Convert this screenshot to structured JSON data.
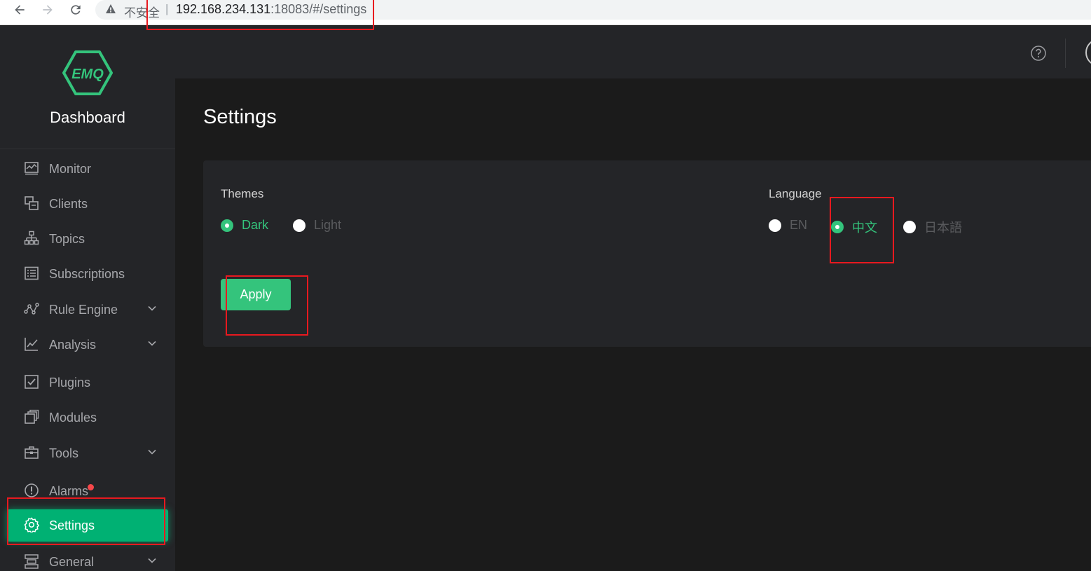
{
  "browser": {
    "insecure_label": "不安全",
    "separator": "|",
    "url_host": "192.168.234.131",
    "url_path": ":18083/#/settings"
  },
  "sidebar": {
    "brand": "Dashboard",
    "logo_text": "EMQ",
    "items": [
      {
        "label": "Monitor",
        "icon": "monitor-icon"
      },
      {
        "label": "Clients",
        "icon": "clients-icon"
      },
      {
        "label": "Topics",
        "icon": "topics-icon"
      },
      {
        "label": "Subscriptions",
        "icon": "subscriptions-icon"
      },
      {
        "label": "Rule Engine",
        "icon": "rule-engine-icon",
        "expandable": true
      },
      {
        "label": "Analysis",
        "icon": "analysis-icon",
        "expandable": true
      },
      {
        "label": "Plugins",
        "icon": "plugins-icon"
      },
      {
        "label": "Modules",
        "icon": "modules-icon"
      },
      {
        "label": "Tools",
        "icon": "tools-icon",
        "expandable": true
      },
      {
        "label": "Alarms",
        "icon": "alarm-icon",
        "badge": true
      },
      {
        "label": "Settings",
        "icon": "gear-icon",
        "active": true
      },
      {
        "label": "General",
        "icon": "general-icon",
        "expandable": true
      }
    ]
  },
  "page": {
    "title": "Settings",
    "themes": {
      "label": "Themes",
      "options": [
        "Dark",
        "Light"
      ],
      "selected": "Dark"
    },
    "language": {
      "label": "Language",
      "options": [
        "EN",
        "中文",
        "日本語"
      ],
      "selected": "中文"
    },
    "apply_label": "Apply"
  },
  "colors": {
    "accent": "#34c47c",
    "active_menu": "#00b173",
    "sidebar_bg": "#242528",
    "page_bg": "#1b1b1b",
    "highlight": "#e8191f",
    "alarm_dot": "#f5474a"
  }
}
